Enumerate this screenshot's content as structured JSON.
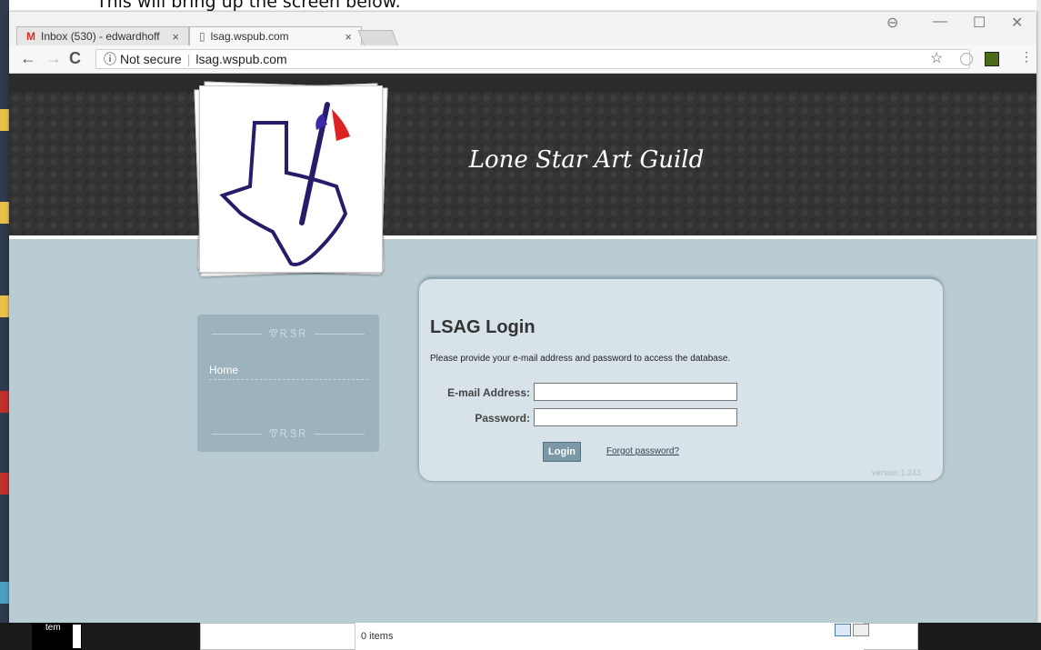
{
  "doc_caption": "This will bring up the screen below.",
  "browser": {
    "tabs": [
      {
        "label": "Inbox (530) - edwardhoff",
        "close": "×"
      },
      {
        "label": "lsag.wspub.com",
        "close": "×"
      }
    ],
    "window_controls": {
      "minimize": "—",
      "maximize": "☐",
      "close": "✕"
    },
    "back": "←",
    "forward": "→",
    "reload": "C",
    "security_label": "Not secure",
    "url": "lsag.wspub.com",
    "star": "☆"
  },
  "site": {
    "title": "Lone Star Art Guild"
  },
  "nav": {
    "ornament": "ᏡᎡᏕᏒ",
    "items": [
      {
        "label": "Home"
      }
    ]
  },
  "login": {
    "heading": "LSAG Login",
    "description": "Please provide your e-mail address and password to access the database.",
    "email_label": "E-mail Address:",
    "email_value": "",
    "password_label": "Password:",
    "password_value": "",
    "button": "Login",
    "forgot": "Forgot password?",
    "version": "version 1.243"
  },
  "taskbar": {
    "left_text": "tem",
    "items": "0 items"
  }
}
